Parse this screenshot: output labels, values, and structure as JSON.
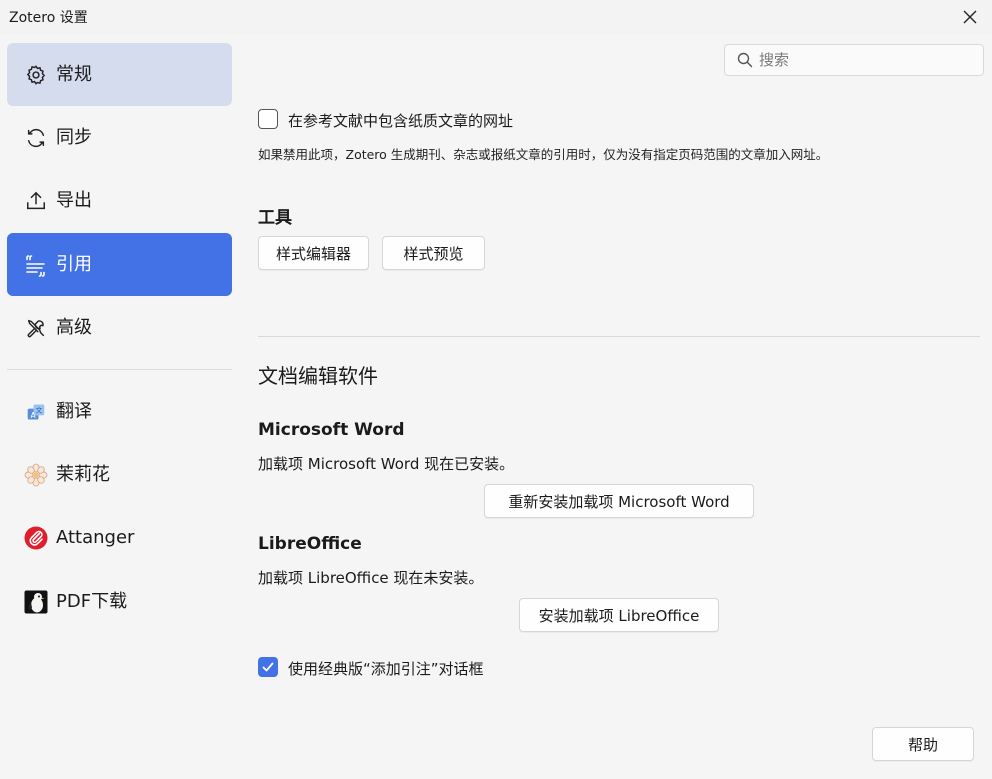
{
  "window": {
    "title": "Zotero 设置"
  },
  "sidebar": {
    "items": [
      {
        "label": "常规",
        "icon": "gear-icon"
      },
      {
        "label": "同步",
        "icon": "sync-icon"
      },
      {
        "label": "导出",
        "icon": "export-icon"
      },
      {
        "label": "引用",
        "icon": "quote-icon"
      },
      {
        "label": "高级",
        "icon": "tools-icon"
      },
      {
        "label": "翻译",
        "icon": "translate-icon"
      },
      {
        "label": "茉莉花",
        "icon": "jasmine-flower-icon"
      },
      {
        "label": "Attanger",
        "icon": "attanger-paperclip-icon"
      },
      {
        "label": "PDF下载",
        "icon": "pdf-download-penguin-icon"
      }
    ]
  },
  "search": {
    "placeholder": "搜索"
  },
  "main": {
    "url_option": {
      "label": "在参考文献中包含纸质文章的网址",
      "checked": false,
      "description": "如果禁用此项，Zotero 生成期刊、杂志或报纸文章的引用时，仅为没有指定页码范围的文章加入网址。"
    },
    "tools": {
      "heading": "工具",
      "style_editor_label": "样式编辑器",
      "style_preview_label": "样式预览"
    },
    "word_processors": {
      "heading": "文档编辑软件",
      "word": {
        "heading": "Microsoft Word",
        "status": "加载项 Microsoft Word 现在已安装。",
        "button_label": "重新安装加载项 Microsoft Word"
      },
      "libreoffice": {
        "heading": "LibreOffice",
        "status": "加载项 LibreOffice 现在未安装。",
        "button_label": "安装加载项 LibreOffice"
      },
      "classic_dialog": {
        "label": "使用经典版“添加引注”对话框",
        "checked": true
      }
    },
    "help_label": "帮助"
  },
  "colors": {
    "accent": "#4272e6",
    "selected_light": "#d4dcee",
    "background": "#f5f5f5"
  }
}
